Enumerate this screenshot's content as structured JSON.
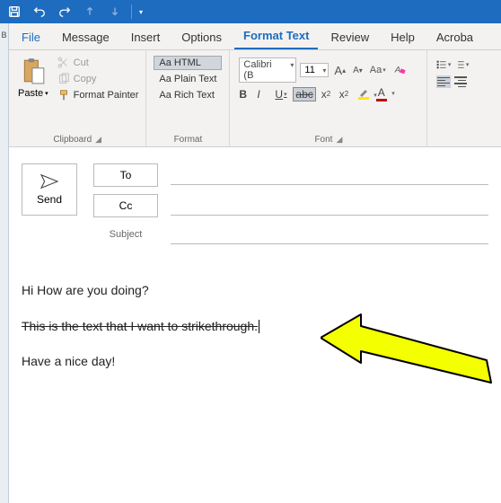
{
  "tabs": {
    "file": "File",
    "message": "Message",
    "insert": "Insert",
    "options": "Options",
    "format_text": "Format Text",
    "review": "Review",
    "help": "Help",
    "acrobat": "Acroba"
  },
  "clipboard": {
    "paste": "Paste",
    "cut": "Cut",
    "copy": "Copy",
    "format_painter": "Format Painter",
    "group": "Clipboard"
  },
  "format": {
    "html": "Aa HTML",
    "plain": "Aa Plain Text",
    "rich": "Aa Rich Text",
    "group": "Format"
  },
  "font": {
    "name": "Calibri (B",
    "size": "11",
    "group": "Font",
    "grow": "A",
    "shrink": "A",
    "case": "Aa",
    "b": "B",
    "i": "I",
    "u": "U",
    "strike": "abc",
    "sub": "x",
    "sup": "x",
    "a_font": "A"
  },
  "compose": {
    "send": "Send",
    "to": "To",
    "cc": "Cc",
    "subject": "Subject"
  },
  "body": {
    "l1": "Hi How are you doing?",
    "l2": "This is the text that I want to strikethrough.",
    "l3": "Have a nice day!"
  },
  "left_edge": "B"
}
